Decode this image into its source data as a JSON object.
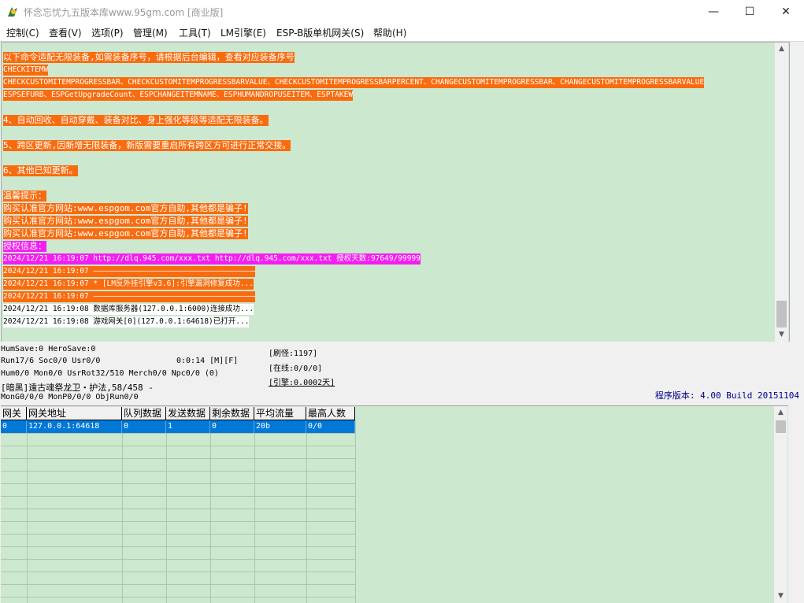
{
  "window": {
    "title": "怀念忘忧九五版本库www.95gm.com [商业版]",
    "controls": {
      "minimize": "—",
      "maximize": "☐",
      "close": "✕"
    }
  },
  "menu": [
    "控制(C)",
    "查看(V)",
    "选项(P)",
    "管理(M)",
    "工具(T)",
    "LM引擎(E)",
    "ESP-B版单机网关(S)",
    "帮助(H)"
  ],
  "log_lines": [
    {
      "text": "以下命令适配无限装备,如需装备序号，请根据后台编辑，查看对应装备序号",
      "style": "orange",
      "size": "big"
    },
    {
      "text": "CHECKITEMW",
      "style": "orange"
    },
    {
      "text": "CHECKCUSTOMITEMPROGRESSBAR、CHECKCUSTOMITEMPROGRESSBARVALUE、CHECKCUSTOMITEMPROGRESSBARPERCENT、CHANGECUSTOMITEMPROGRESSBAR、CHANGECUSTOMITEMPROGRESSBARVALUE",
      "style": "orange"
    },
    {
      "text": "ESPSEFURB、ESPGetUpgradeCount、ESPCHANGEITEMNAME、ESPHUMANDROPUSEITEM、ESPTAKEW",
      "style": "orange"
    },
    {
      "text": "4、自动回收、自动穿戴、装备对比、身上强化等级等适配无限装备。",
      "style": "orange",
      "size": "big"
    },
    {
      "text": "5、跨区更新,因新增无限装备，新版需要重启所有跨区方可进行正常交接。",
      "style": "orange",
      "size": "big"
    },
    {
      "text": "6、其他已知更新。",
      "style": "orange",
      "size": "big"
    },
    {
      "text": "温馨提示：",
      "style": "orange",
      "size": "big"
    },
    {
      "text": "购买认准官方网站:www.espgom.com官方自助,其他都是骗子!",
      "style": "orange",
      "size": "big"
    },
    {
      "text": "购买认准官方网站:www.espgom.com官方自助,其他都是骗子!",
      "style": "orange",
      "size": "big"
    },
    {
      "text": "购买认准官方网站:www.espgom.com官方自助,其他都是骗子!",
      "style": "orange",
      "size": "big"
    },
    {
      "text": "授权信息：",
      "style": "magenta",
      "size": "big"
    },
    {
      "text": "2024/12/21 16:19:07 http://dlq.945.com/xxx.txt http://dlq.945.com/xxx.txt 授权天数:97649/99999",
      "style": "magenta"
    },
    {
      "text": "2024/12/21 16:19:07 ————————————————————————————————————",
      "style": "orange"
    },
    {
      "text": "2024/12/21 16:19:07 * [LM反外挂引擎v3.6]:引擎漏洞修复成功...",
      "style": "orange"
    },
    {
      "text": "2024/12/21 16:19:07 ————————————————————————————————————",
      "style": "orange"
    },
    {
      "text": "2024/12/21 16:19:08 数据库服务器(127.0.0.1:6000)连接成功...",
      "style": "white"
    },
    {
      "text": "2024/12/21 16:19:08 游戏网关[0](127.0.0.1:64618)已打开...",
      "style": "white"
    }
  ],
  "status": {
    "line1": "HumSave:0 HeroSave:0",
    "line2a": "Run17/6 Soc0/0 Usr0/0",
    "line2b": "0:0:14 [M][F]",
    "line3": "Hum0/0 Mon0/0 UsrRot32/510 Merch0/0 Npc0/0 (0)",
    "line4": "[暗黑]遠古魂祭龙卫・护法,58/458 -",
    "line5": "MonG0/0/0 MonP0/0/0 ObjRun0/0",
    "refresh": "[刷怪:1197]",
    "online": "[在线:0/0/0]",
    "engine": "[引擎:0.0002天]",
    "version": "程序版本: 4.00 Build 20151104"
  },
  "gateway_table": {
    "headers": [
      "网关",
      "网关地址",
      "队列数据",
      "发送数据",
      "剩余数据",
      "平均流量",
      "最高人数"
    ],
    "rows": [
      [
        "0",
        "127.0.0.1:64618",
        "0",
        "1",
        "0",
        "20b",
        "0/0"
      ]
    ]
  },
  "scrollbar": {
    "up": "▲",
    "down": "▼"
  },
  "colors": {
    "log_bg": "#cce8cf",
    "orange": "#f86c0f",
    "magenta": "#f31ff0",
    "selection": "#0078d7",
    "version": "#00008b"
  }
}
